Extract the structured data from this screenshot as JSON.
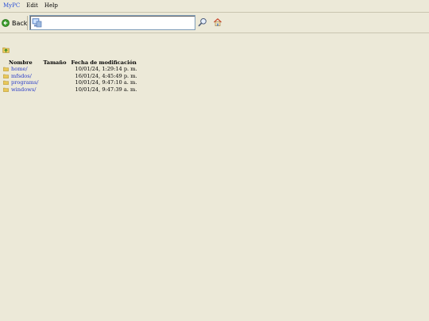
{
  "menubar": {
    "items": [
      {
        "label": "MyPC"
      },
      {
        "label": "Edit"
      },
      {
        "label": "Help"
      }
    ]
  },
  "toolbar": {
    "back_label": "Back",
    "address_value": "",
    "icons": {
      "back": "back-arrow-icon",
      "address": "computer-icon",
      "go": "magnifier-icon",
      "home": "home-icon"
    }
  },
  "up_folder_icon": "folder-up-icon",
  "table": {
    "headers": {
      "name": "Nombre",
      "size": "Tamaño",
      "modified": "Fecha de modificación"
    },
    "rows": [
      {
        "name": "home/",
        "size": "",
        "modified": "10/01/24, 1:29:14 p. m."
      },
      {
        "name": "mfsdos/",
        "size": "",
        "modified": "16/01/24, 4:45:49 p. m."
      },
      {
        "name": "programs/",
        "size": "",
        "modified": "10/01/24, 9:47:10 a. m."
      },
      {
        "name": "windows/",
        "size": "",
        "modified": "10/01/24, 9:47:39 a. m."
      }
    ]
  },
  "colors": {
    "background": "#ece9d8",
    "link": "#2a3cc8",
    "brand": "#2a4fd6"
  }
}
